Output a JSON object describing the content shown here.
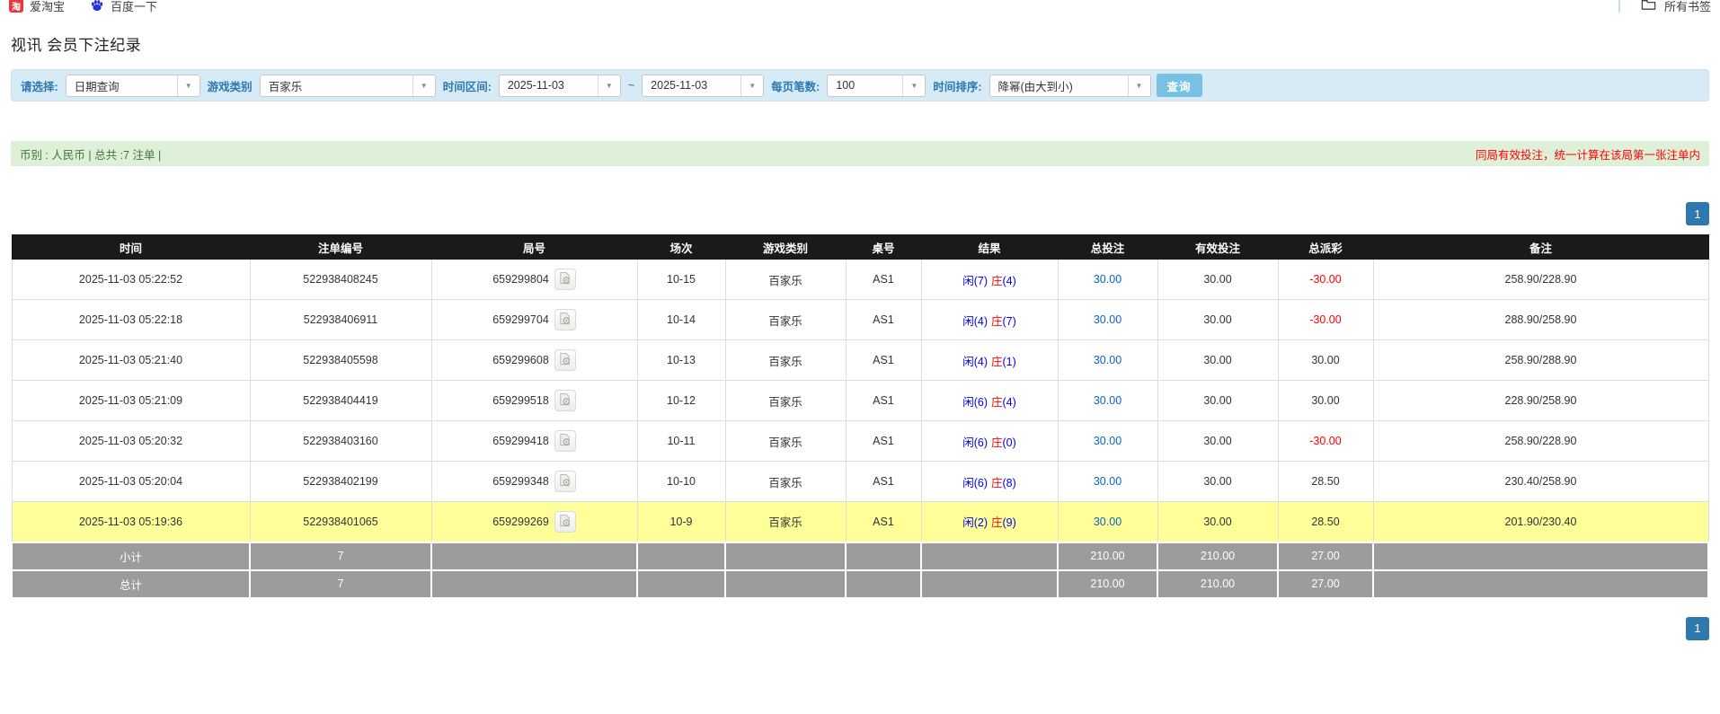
{
  "bookmarks_bar": {
    "items": [
      {
        "label": "爱淘宝",
        "icon_char": "淘"
      },
      {
        "label": "百度一下"
      }
    ],
    "all_bookmarks_label": "所有书签"
  },
  "page": {
    "title": "视讯 会员下注纪录"
  },
  "filters": {
    "select_label": "请选择:",
    "select_value": "日期查询",
    "game_category_label": "游戏类别",
    "game_category_value": "百家乐",
    "time_range_label": "时间区间:",
    "date_from": "2025-11-03",
    "range_separator": "~",
    "date_to": "2025-11-03",
    "page_size_label": "每页笔数:",
    "page_size_value": "100",
    "sort_label": "时间排序:",
    "sort_value": "降幂(由大到小)",
    "search_button": "查询"
  },
  "summary_bar": {
    "left_text": "币别 : 人民币 | 总共 :7 注单 |",
    "right_notice": "同局有效投注，统一计算在该局第一张注单内"
  },
  "pagination": {
    "page": "1"
  },
  "colors": {
    "header_bg": "#1a1a1a",
    "highlight_row": "#ffff99",
    "summary_row": "#9c9c9c",
    "player_blue": "#0000ee",
    "banker_red": "#ff0000",
    "negative_red": "#ff0000",
    "link_blue": "#0b62c4",
    "filter_bg": "#d7ebf7",
    "green_bar_bg": "#dff0d8",
    "green_text": "#3c763d",
    "search_button_bg": "#79c1e2",
    "pager_blue": "#2e78ad"
  },
  "table": {
    "headers": [
      "时间",
      "注单编号",
      "局号",
      "场次",
      "游戏类别",
      "桌号",
      "结果",
      "总投注",
      "有效投注",
      "总派彩",
      "备注"
    ],
    "rows": [
      {
        "time": "2025-11-03 05:22:52",
        "bet_id": "522938408245",
        "round_id": "659299804",
        "session": "10-15",
        "game": "百家乐",
        "table_no": "AS1",
        "result": {
          "player": "闲(7)",
          "banker": "庄",
          "banker_pts": "(4)"
        },
        "total_bet": "30.00",
        "valid_bet": "30.00",
        "payout": "-30.00",
        "remark": "258.90/228.90",
        "highlight": false
      },
      {
        "time": "2025-11-03 05:22:18",
        "bet_id": "522938406911",
        "round_id": "659299704",
        "session": "10-14",
        "game": "百家乐",
        "table_no": "AS1",
        "result": {
          "player": "闲(4)",
          "banker": "庄",
          "banker_pts": "(7)"
        },
        "total_bet": "30.00",
        "valid_bet": "30.00",
        "payout": "-30.00",
        "remark": "288.90/258.90",
        "highlight": false
      },
      {
        "time": "2025-11-03 05:21:40",
        "bet_id": "522938405598",
        "round_id": "659299608",
        "session": "10-13",
        "game": "百家乐",
        "table_no": "AS1",
        "result": {
          "player": "闲(4)",
          "banker": "庄",
          "banker_pts": "(1)"
        },
        "total_bet": "30.00",
        "valid_bet": "30.00",
        "payout": "30.00",
        "remark": "258.90/288.90",
        "highlight": false
      },
      {
        "time": "2025-11-03 05:21:09",
        "bet_id": "522938404419",
        "round_id": "659299518",
        "session": "10-12",
        "game": "百家乐",
        "table_no": "AS1",
        "result": {
          "player": "闲(6)",
          "banker": "庄",
          "banker_pts": "(4)"
        },
        "total_bet": "30.00",
        "valid_bet": "30.00",
        "payout": "30.00",
        "remark": "228.90/258.90",
        "highlight": false
      },
      {
        "time": "2025-11-03 05:20:32",
        "bet_id": "522938403160",
        "round_id": "659299418",
        "session": "10-11",
        "game": "百家乐",
        "table_no": "AS1",
        "result": {
          "player": "闲(6)",
          "banker": "庄",
          "banker_pts": "(0)"
        },
        "total_bet": "30.00",
        "valid_bet": "30.00",
        "payout": "-30.00",
        "remark": "258.90/228.90",
        "highlight": false
      },
      {
        "time": "2025-11-03 05:20:04",
        "bet_id": "522938402199",
        "round_id": "659299348",
        "session": "10-10",
        "game": "百家乐",
        "table_no": "AS1",
        "result": {
          "player": "闲(6)",
          "banker": "庄",
          "banker_pts": "(8)"
        },
        "total_bet": "30.00",
        "valid_bet": "30.00",
        "payout": "28.50",
        "remark": "230.40/258.90",
        "highlight": false
      },
      {
        "time": "2025-11-03 05:19:36",
        "bet_id": "522938401065",
        "round_id": "659299269",
        "session": "10-9",
        "game": "百家乐",
        "table_no": "AS1",
        "result": {
          "player": "闲(2)",
          "banker": "庄",
          "banker_pts": "(9)"
        },
        "total_bet": "30.00",
        "valid_bet": "30.00",
        "payout": "28.50",
        "remark": "201.90/230.40",
        "highlight": true
      }
    ],
    "subtotal": {
      "label": "小计",
      "count": "7",
      "total_bet": "210.00",
      "valid_bet": "210.00",
      "total_payout": "27.00"
    },
    "total": {
      "label": "总计",
      "count": "7",
      "total_bet": "210.00",
      "valid_bet": "210.00",
      "total_payout": "27.00"
    }
  }
}
